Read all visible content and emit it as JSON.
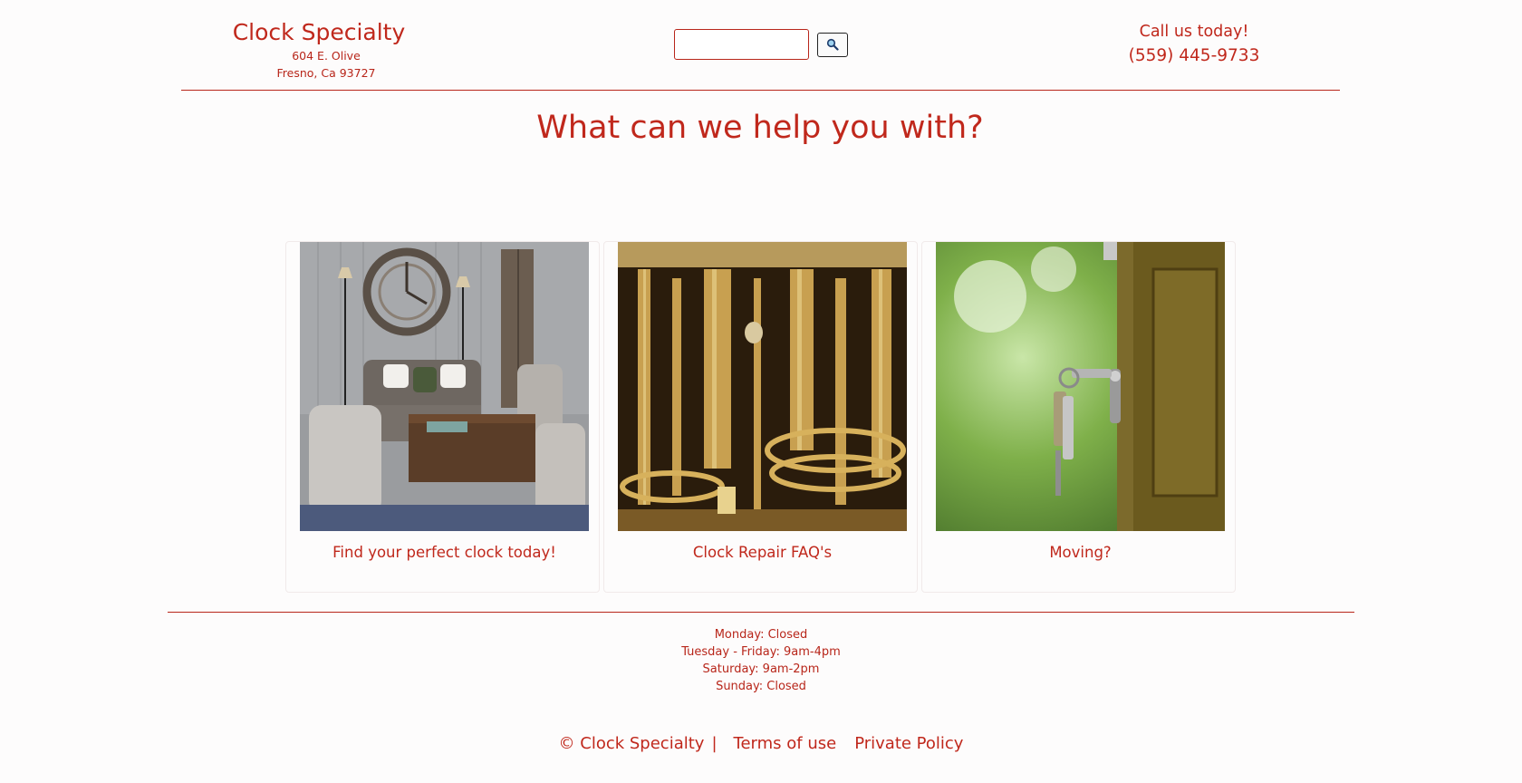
{
  "header": {
    "brand_name": "Clock Specialty",
    "address_line1": "604 E. Olive",
    "address_line2": "Fresno, Ca 93727",
    "search_placeholder": "",
    "search_icon": "magnifier-icon",
    "call_label": "Call us today!",
    "phone": "(559) 445-9733"
  },
  "main": {
    "headline": "What can we help you with?",
    "cards": [
      {
        "caption": "Find your perfect clock today!",
        "image": "living-room-with-wall-clock"
      },
      {
        "caption": "Clock Repair FAQ's",
        "image": "brass-clock-mechanism"
      },
      {
        "caption": "Moving?",
        "image": "keys-in-door-lock"
      }
    ]
  },
  "hours": [
    "Monday: Closed",
    "Tuesday - Friday: 9am-4pm",
    "Saturday: 9am-2pm",
    "Sunday: Closed"
  ],
  "footer": {
    "copyright": "© Clock Specialty",
    "separator": "|",
    "terms": "Terms of use",
    "privacy": "Private Policy"
  },
  "colors": {
    "accent": "#c0281c",
    "background": "#fdfcfc"
  }
}
